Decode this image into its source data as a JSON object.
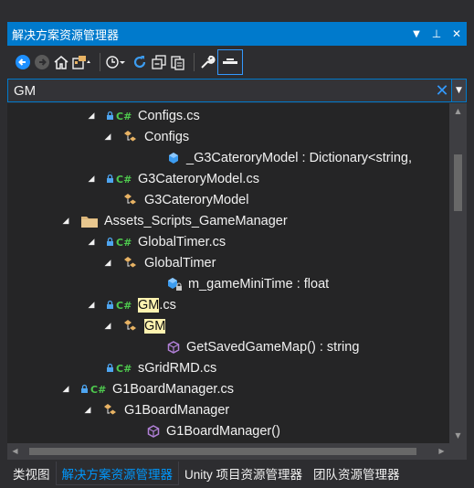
{
  "window": {
    "title": "解决方案资源管理器",
    "buttons": [
      "▼",
      "⊥",
      "✕"
    ]
  },
  "search": {
    "value": "GM"
  },
  "tree": [
    {
      "indent": 108,
      "arrow": "◢",
      "icons": [
        "lock-icon",
        "csharp-icon"
      ],
      "label": "Configs.cs"
    },
    {
      "indent": 126,
      "arrow": "◢",
      "icons": [
        "class-icon"
      ],
      "label": "Configs"
    },
    {
      "indent": 174,
      "arrow": "",
      "icons": [
        "field-icon"
      ],
      "label": "_G3CateroryModel : Dictionary<string,"
    },
    {
      "indent": 108,
      "arrow": "◢",
      "icons": [
        "lock-icon",
        "csharp-icon"
      ],
      "label": "G3CateroryModel.cs"
    },
    {
      "indent": 126,
      "arrow": "",
      "icons": [
        "class-icon"
      ],
      "label": "G3CateroryModel"
    },
    {
      "indent": 80,
      "arrow": "◢",
      "icons": [
        "folder-icon"
      ],
      "label": "Assets_Scripts_GameManager"
    },
    {
      "indent": 108,
      "arrow": "◢",
      "icons": [
        "lock-icon",
        "csharp-icon"
      ],
      "label": "GlobalTimer.cs"
    },
    {
      "indent": 126,
      "arrow": "◢",
      "icons": [
        "class-icon"
      ],
      "label": "GlobalTimer"
    },
    {
      "indent": 174,
      "arrow": "",
      "icons": [
        "field-lock-icon"
      ],
      "label": "m_gameMiniTime : float"
    },
    {
      "indent": 108,
      "arrow": "◢",
      "icons": [
        "lock-icon",
        "csharp-icon"
      ],
      "label": "GM.cs",
      "hl": "GM"
    },
    {
      "indent": 126,
      "arrow": "◢",
      "icons": [
        "class-icon"
      ],
      "label": "GM",
      "hl": "GM"
    },
    {
      "indent": 174,
      "arrow": "",
      "icons": [
        "method-icon"
      ],
      "label": "GetSavedGameMap() : string"
    },
    {
      "indent": 108,
      "arrow": "",
      "icons": [
        "lock-icon",
        "csharp-icon"
      ],
      "label": "sGridRMD.cs"
    },
    {
      "indent": 80,
      "arrow": "◢",
      "icons": [
        "lock-icon",
        "csharp-icon"
      ],
      "label": "G1BoardManager.cs"
    },
    {
      "indent": 104,
      "arrow": "◢",
      "icons": [
        "class-icon"
      ],
      "label": "G1BoardManager"
    },
    {
      "indent": 152,
      "arrow": "",
      "icons": [
        "method-icon"
      ],
      "label": "G1BoardManager()"
    }
  ],
  "tabs": [
    {
      "label": "类视图",
      "active": false
    },
    {
      "label": "解决方案资源管理器",
      "active": true
    },
    {
      "label": "Unity 项目资源管理器",
      "active": false
    },
    {
      "label": "团队资源管理器",
      "active": false
    }
  ],
  "colors": {
    "accent": "#007acc",
    "background": "#252526",
    "chrome": "#2d2d30",
    "highlight": "#fff3b0",
    "csharp_green": "#4ec94e",
    "lock_blue": "#4ea5f0",
    "class_orange": "#e8b364",
    "method_purple": "#b180d7"
  }
}
